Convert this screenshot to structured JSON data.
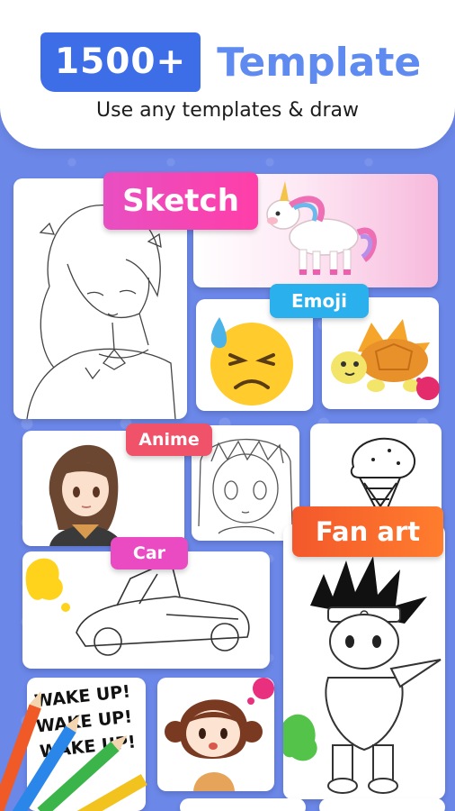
{
  "header": {
    "count_badge": "1500+",
    "title": "Template",
    "subtitle": "Use any templates & draw"
  },
  "categories": {
    "sketch": "Sketch",
    "emoji": "Emoji",
    "anime": "Anime",
    "car": "Car",
    "fan_art": "Fan art"
  },
  "artwork": {
    "wake_up_text": "WAKE UP!"
  },
  "colors": {
    "background": "#6b87e8",
    "badge_blue": "#3d6ee8",
    "title_blue": "#5f8aef",
    "sketch_pink": "#ff3ea8",
    "emoji_blue": "#2ab0ec",
    "anime_red": "#f0526a",
    "car_magenta": "#ea4bc2",
    "fanart_orange": "#f3582c"
  }
}
